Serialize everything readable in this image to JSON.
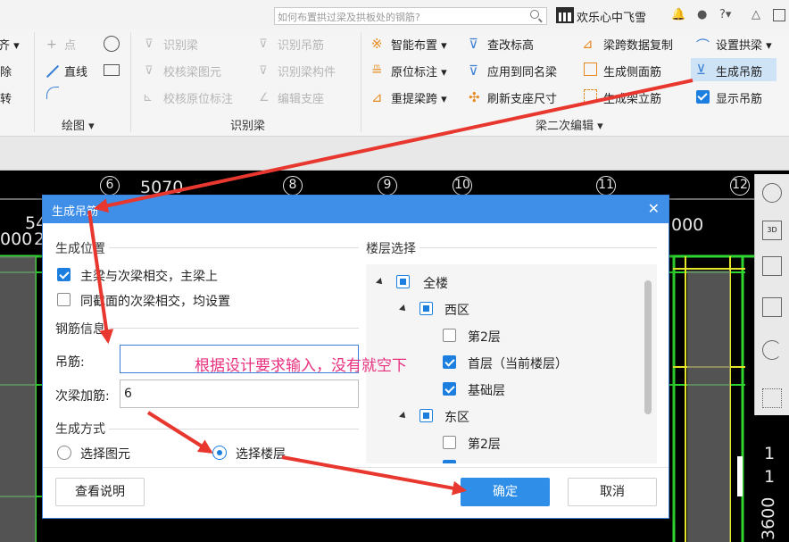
{
  "topbar": {
    "search_placeholder": "如何布置拱过梁及拱板处的钢筋?",
    "username": "欢乐心中飞雪",
    "icons": [
      "bell-icon",
      "chat-icon",
      "help-icon",
      "shirt-icon",
      "restore-window-icon"
    ]
  },
  "ribbon": {
    "left_partial": [
      "齐 ▾",
      "除",
      "转"
    ],
    "draw_group": {
      "point": "点",
      "line": "直线",
      "label": "绘图 ▾"
    },
    "identify_group": {
      "identify_beam": "识别梁",
      "check_beam_element": "校核梁图元",
      "check_original_annotation": "校核原位标注",
      "identify_hanger": "识别吊筋",
      "identify_beam_component": "识别梁构件",
      "edit_support": "编辑支座",
      "label": "识别梁"
    },
    "secondary_edit_group": {
      "smart_layout": "智能布置 ▾",
      "original_annotation": "原位标注 ▾",
      "re_extract_span": "重提梁跨 ▾",
      "check_elevation": "查改标高",
      "apply_same_name": "应用到同名梁",
      "refresh_support_size": "刷新支座尺寸",
      "copy_span_data": "梁跨数据复制",
      "generate_side_rebar": "生成侧面筋",
      "generate_stirrup_rebar": "生成架立筋",
      "set_arch_beam": "设置拱梁 ▾",
      "generate_hanger": "生成吊筋",
      "show_hanger": "显示吊筋",
      "label": "梁二次编辑 ▾"
    }
  },
  "cad": {
    "axis_numbers": [
      "6",
      "8",
      "9",
      "10",
      "11",
      "12"
    ],
    "partial_texts": [
      "5070",
      "54",
      "000",
      "2",
      "000",
      "1",
      "1",
      "3600"
    ]
  },
  "dialog": {
    "title": "生成吊筋",
    "position_section": "生成位置",
    "opt_main_secondary": "主梁与次梁相交，主梁上",
    "opt_same_section": "同截面的次梁相交，均设置",
    "rebar_section": "钢筋信息",
    "hanger_label": "吊筋:",
    "hanger_value": "",
    "extra_label": "次梁加筋:",
    "extra_value": "6",
    "method_section": "生成方式",
    "radio_element": "选择图元",
    "radio_floor": "选择楼层",
    "floor_section": "楼层选择",
    "tree": {
      "all": "全楼",
      "west": "西区",
      "west_floor2": "第2层",
      "west_floor1": "首层（当前楼层）",
      "west_base": "基础层",
      "east": "东区",
      "east_floor2": "第2层"
    },
    "help_button": "查看说明",
    "ok_button": "确定",
    "cancel_button": "取消"
  },
  "annotation": "根据设计要求输入，没有就空下",
  "colors": {
    "accent": "#3f8ee7",
    "primary_button": "#2f8fe8",
    "annotation": "#e8307f",
    "arrow": "#e8372e"
  }
}
